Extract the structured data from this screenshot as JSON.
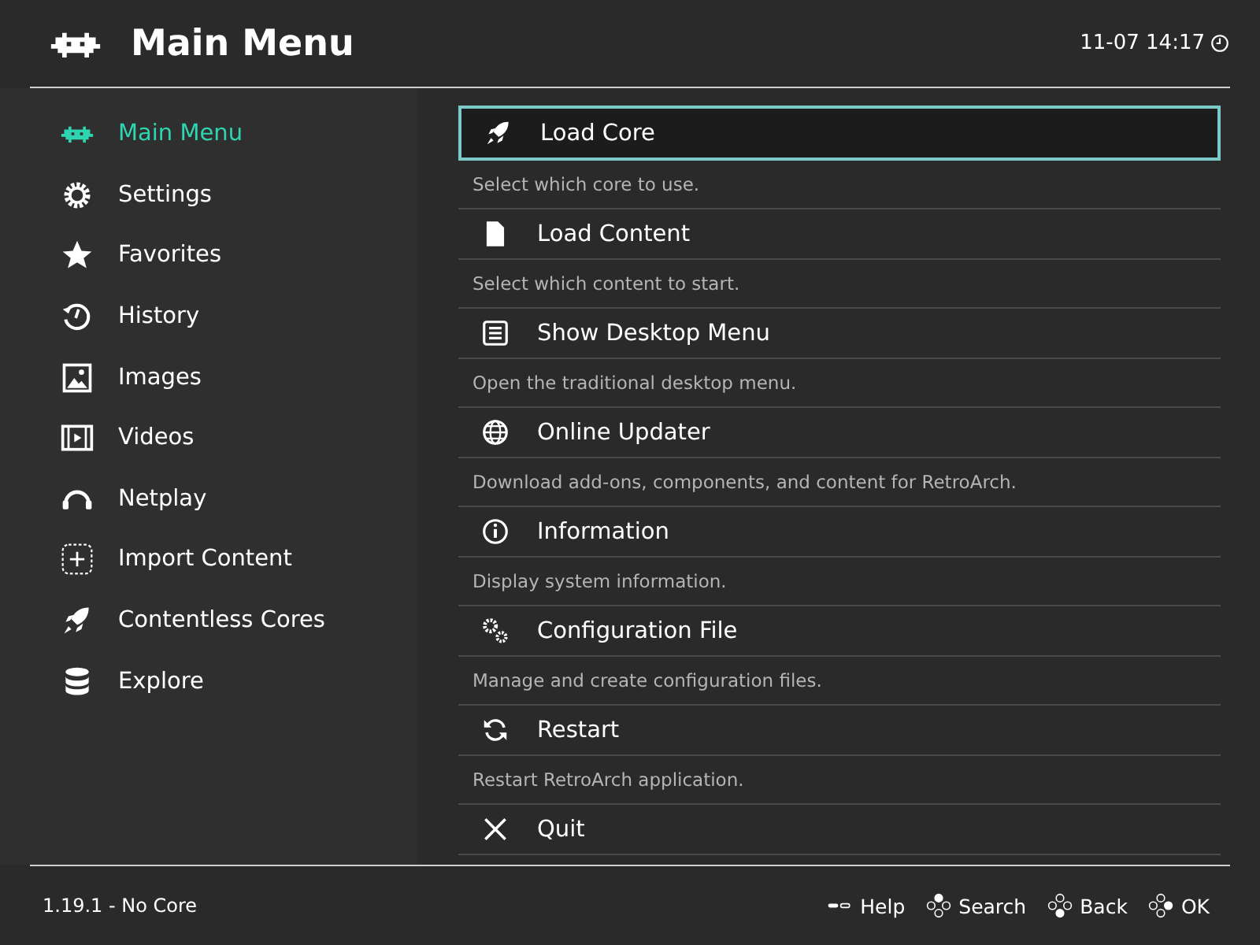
{
  "header": {
    "title": "Main Menu",
    "clock": "11-07 14:17"
  },
  "sidebar": {
    "items": [
      {
        "label": "Main Menu",
        "selected": true
      },
      {
        "label": "Settings",
        "selected": false
      },
      {
        "label": "Favorites",
        "selected": false
      },
      {
        "label": "History",
        "selected": false
      },
      {
        "label": "Images",
        "selected": false
      },
      {
        "label": "Videos",
        "selected": false
      },
      {
        "label": "Netplay",
        "selected": false
      },
      {
        "label": "Import Content",
        "selected": false
      },
      {
        "label": "Contentless Cores",
        "selected": false
      },
      {
        "label": "Explore",
        "selected": false
      }
    ]
  },
  "menu": {
    "items": [
      {
        "label": "Load Core",
        "description": "Select which core to use.",
        "selected": true
      },
      {
        "label": "Load Content",
        "description": "Select which content to start.",
        "selected": false
      },
      {
        "label": "Show Desktop Menu",
        "description": "Open the traditional desktop menu.",
        "selected": false
      },
      {
        "label": "Online Updater",
        "description": "Download add-ons, components, and content for RetroArch.",
        "selected": false
      },
      {
        "label": "Information",
        "description": "Display system information.",
        "selected": false
      },
      {
        "label": "Configuration File",
        "description": "Manage and create configuration files.",
        "selected": false
      },
      {
        "label": "Restart",
        "description": "Restart RetroArch application.",
        "selected": false
      },
      {
        "label": "Quit",
        "selected": false
      }
    ]
  },
  "footer": {
    "version": "1.19.1 - No Core",
    "hints": [
      "Help",
      "Search",
      "Back",
      "OK"
    ]
  }
}
